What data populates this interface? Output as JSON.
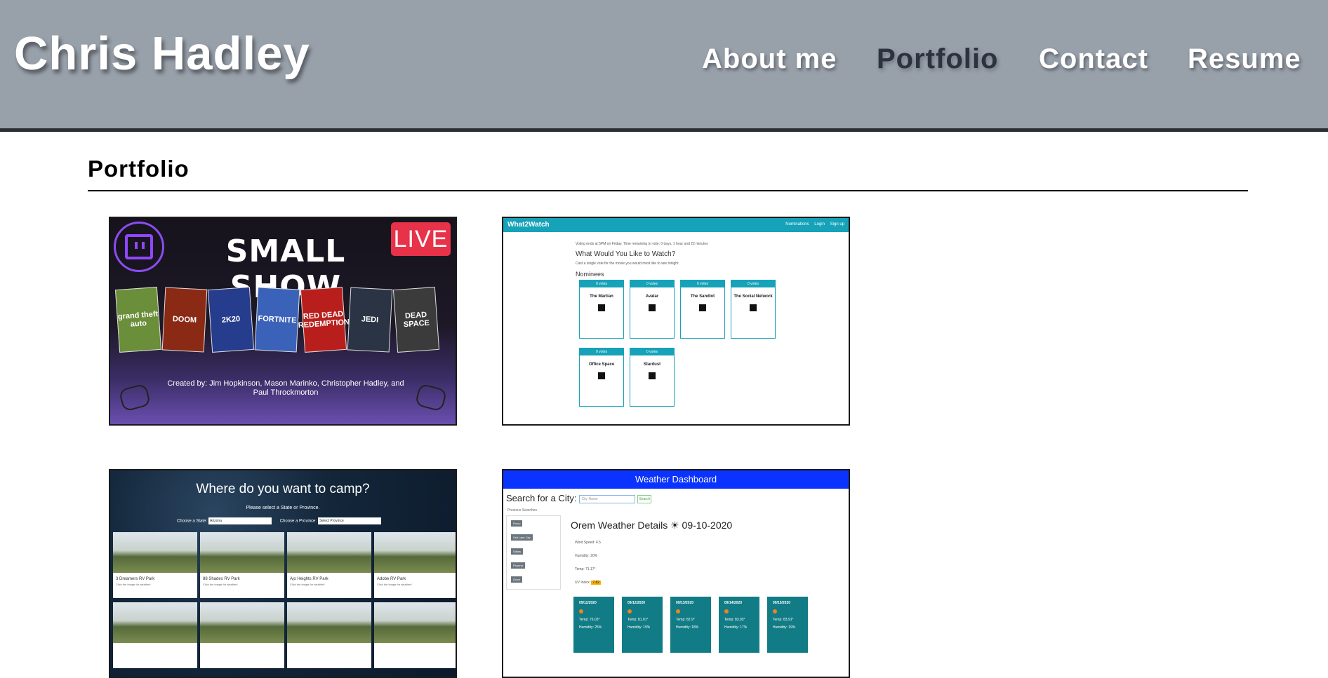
{
  "site": {
    "title": "Chris Hadley",
    "nav": [
      "About me",
      "Portfolio",
      "Contact",
      "Resume"
    ],
    "active_nav": "Portfolio",
    "colors": {
      "header_bg": "#98a0aa",
      "header_rule": "#2b2e33",
      "active_nav": "#2c3340"
    }
  },
  "section": {
    "title": "Portfolio"
  },
  "projects": [
    {
      "id": "small-show",
      "live_badge": "LIVE",
      "title": "SMALL SHOW",
      "credit": "Created by: Jim Hopkinson, Mason Marinko, Christopher Hadley, and Paul Throckmorton",
      "covers": [
        {
          "label": "grand theft auto",
          "color": "#6a8e3a"
        },
        {
          "label": "DOOM",
          "color": "#8a2a14"
        },
        {
          "label": "2K20",
          "color": "#263c8c"
        },
        {
          "label": "FORTNITE",
          "color": "#3a62b8"
        },
        {
          "label": "RED DEAD REDEMPTION",
          "color": "#b81f1c"
        },
        {
          "label": "JEDI",
          "color": "#2b3444"
        },
        {
          "label": "DEAD SPACE",
          "color": "#3b3b3b"
        }
      ]
    },
    {
      "id": "what2watch",
      "brand": "What2Watch",
      "nav": [
        "Nominations",
        "Login",
        "Sign up"
      ],
      "voting_text": "Voting ends at 5PM on Friday. Time remaining to vote: 0 days, 1 hour and 22 minutes",
      "question": "What Would You Like to Watch?",
      "instructions": "Cast a single vote for the movie you would most like to see tonight.",
      "nominees_heading": "Nominees",
      "vote_label": "0 votes",
      "movies": [
        "The Martian",
        "Avatar",
        "The Sandlot",
        "The Social Network",
        "Office Space",
        "Stardust"
      ]
    },
    {
      "id": "campground",
      "title": "Where do you want to camp?",
      "subtitle": "Please select a State or Province.",
      "state_label": "Choose a State:",
      "state_value": "Arizona",
      "province_label": "Choose a Province:",
      "province_value": "Select Province",
      "parks": [
        "3 Dreamers RV Park",
        "88 Shades RV Park",
        "Ajo Heights RV Park",
        "Adobe RV Park"
      ],
      "park_hint": "Click the image for weather!"
    },
    {
      "id": "weather",
      "title": "Weather Dashboard",
      "search_label": "Search for a City:",
      "search_placeholder": "City Name",
      "search_button": "Search",
      "previous_label": "Previous Searches",
      "previous": [
        "Provo",
        "Salt Lake City",
        "Dallas",
        "Phoenix",
        "Orem"
      ],
      "heading": "Orem Weather Details ☀ 09-10-2020",
      "wind": "Wind Speed: 4.5",
      "humidity": "Humidity: 20%",
      "temp": "Temp: 71.17°",
      "uv_label": "UV Index:",
      "uv_value": "7.82",
      "forecast": [
        {
          "date": "09/11/2020",
          "temp": "Temp: 76.03°",
          "humidity": "Humidity: 25%"
        },
        {
          "date": "09/12/2020",
          "temp": "Temp: 81.01°",
          "humidity": "Humidity: 19%"
        },
        {
          "date": "09/13/2020",
          "temp": "Temp: 82.9°",
          "humidity": "Humidity: 18%"
        },
        {
          "date": "09/14/2020",
          "temp": "Temp: 83.93°",
          "humidity": "Humidity: 17%"
        },
        {
          "date": "09/15/2020",
          "temp": "Temp: 83.91°",
          "humidity": "Humidity: 19%"
        }
      ]
    }
  ]
}
